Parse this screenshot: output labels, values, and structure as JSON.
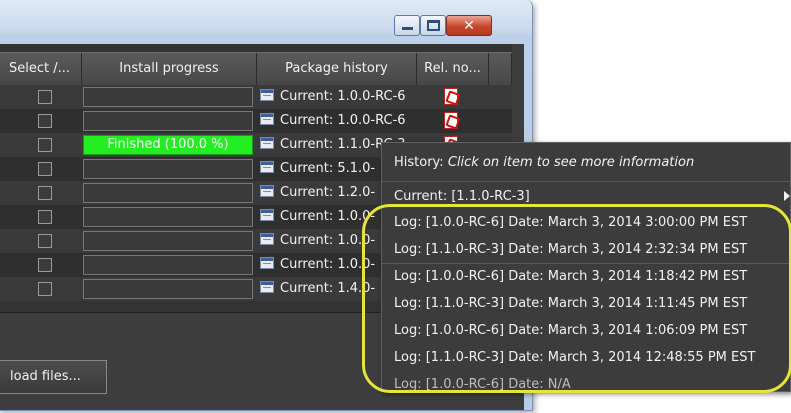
{
  "table": {
    "headers": {
      "select": "Select /...",
      "progress": "Install progress",
      "history": "Package history",
      "relnotes": "Rel. no..."
    },
    "rows": [
      {
        "progress": "",
        "history": "Current: 1.0.0-RC-6"
      },
      {
        "progress": "",
        "history": "Current: 1.0.0-RC-6"
      },
      {
        "progress": "Finished (100.0 %)",
        "history": "Current: 1.1.0-RC-3"
      },
      {
        "progress": "",
        "history": "Current: 5.1.0-"
      },
      {
        "progress": "",
        "history": "Current: 1.2.0-"
      },
      {
        "progress": "",
        "history": "Current: 1.0.0-"
      },
      {
        "progress": "",
        "history": "Current: 1.0.0-"
      },
      {
        "progress": "",
        "history": "Current: 1.0.0-"
      },
      {
        "progress": "",
        "history": "Current: 1.4.0-"
      }
    ],
    "progress_fraction_row3": 1.0
  },
  "download_button": "load files...",
  "menu": {
    "title_prefix": "History: ",
    "title_hint": "Click on item to see more information",
    "current": "Current: [1.1.0-RC-3]",
    "logs": [
      "Log: [1.0.0-RC-6] Date: March 3, 2014 3:00:00 PM EST",
      "Log: [1.1.0-RC-3] Date: March 3, 2014 2:32:34 PM EST",
      "Log: [1.0.0-RC-6] Date: March 3, 2014 1:18:42 PM EST",
      "Log: [1.1.0-RC-3] Date: March 3, 2014 1:11:45 PM EST",
      "Log: [1.0.0-RC-6] Date: March 3, 2014 1:06:09 PM EST",
      "Log: [1.1.0-RC-3] Date: March 3, 2014 12:48:55 PM EST",
      "Log: [1.0.0-RC-6] Date: N/A"
    ]
  },
  "colors": {
    "progress_done": "#22ee22",
    "callout": "#e6e63a",
    "close_button": "#c7462b"
  },
  "icons": {
    "package": "calendar-table-icon",
    "release_notes": "pdf-icon",
    "submenu": "chevron-right-icon"
  }
}
